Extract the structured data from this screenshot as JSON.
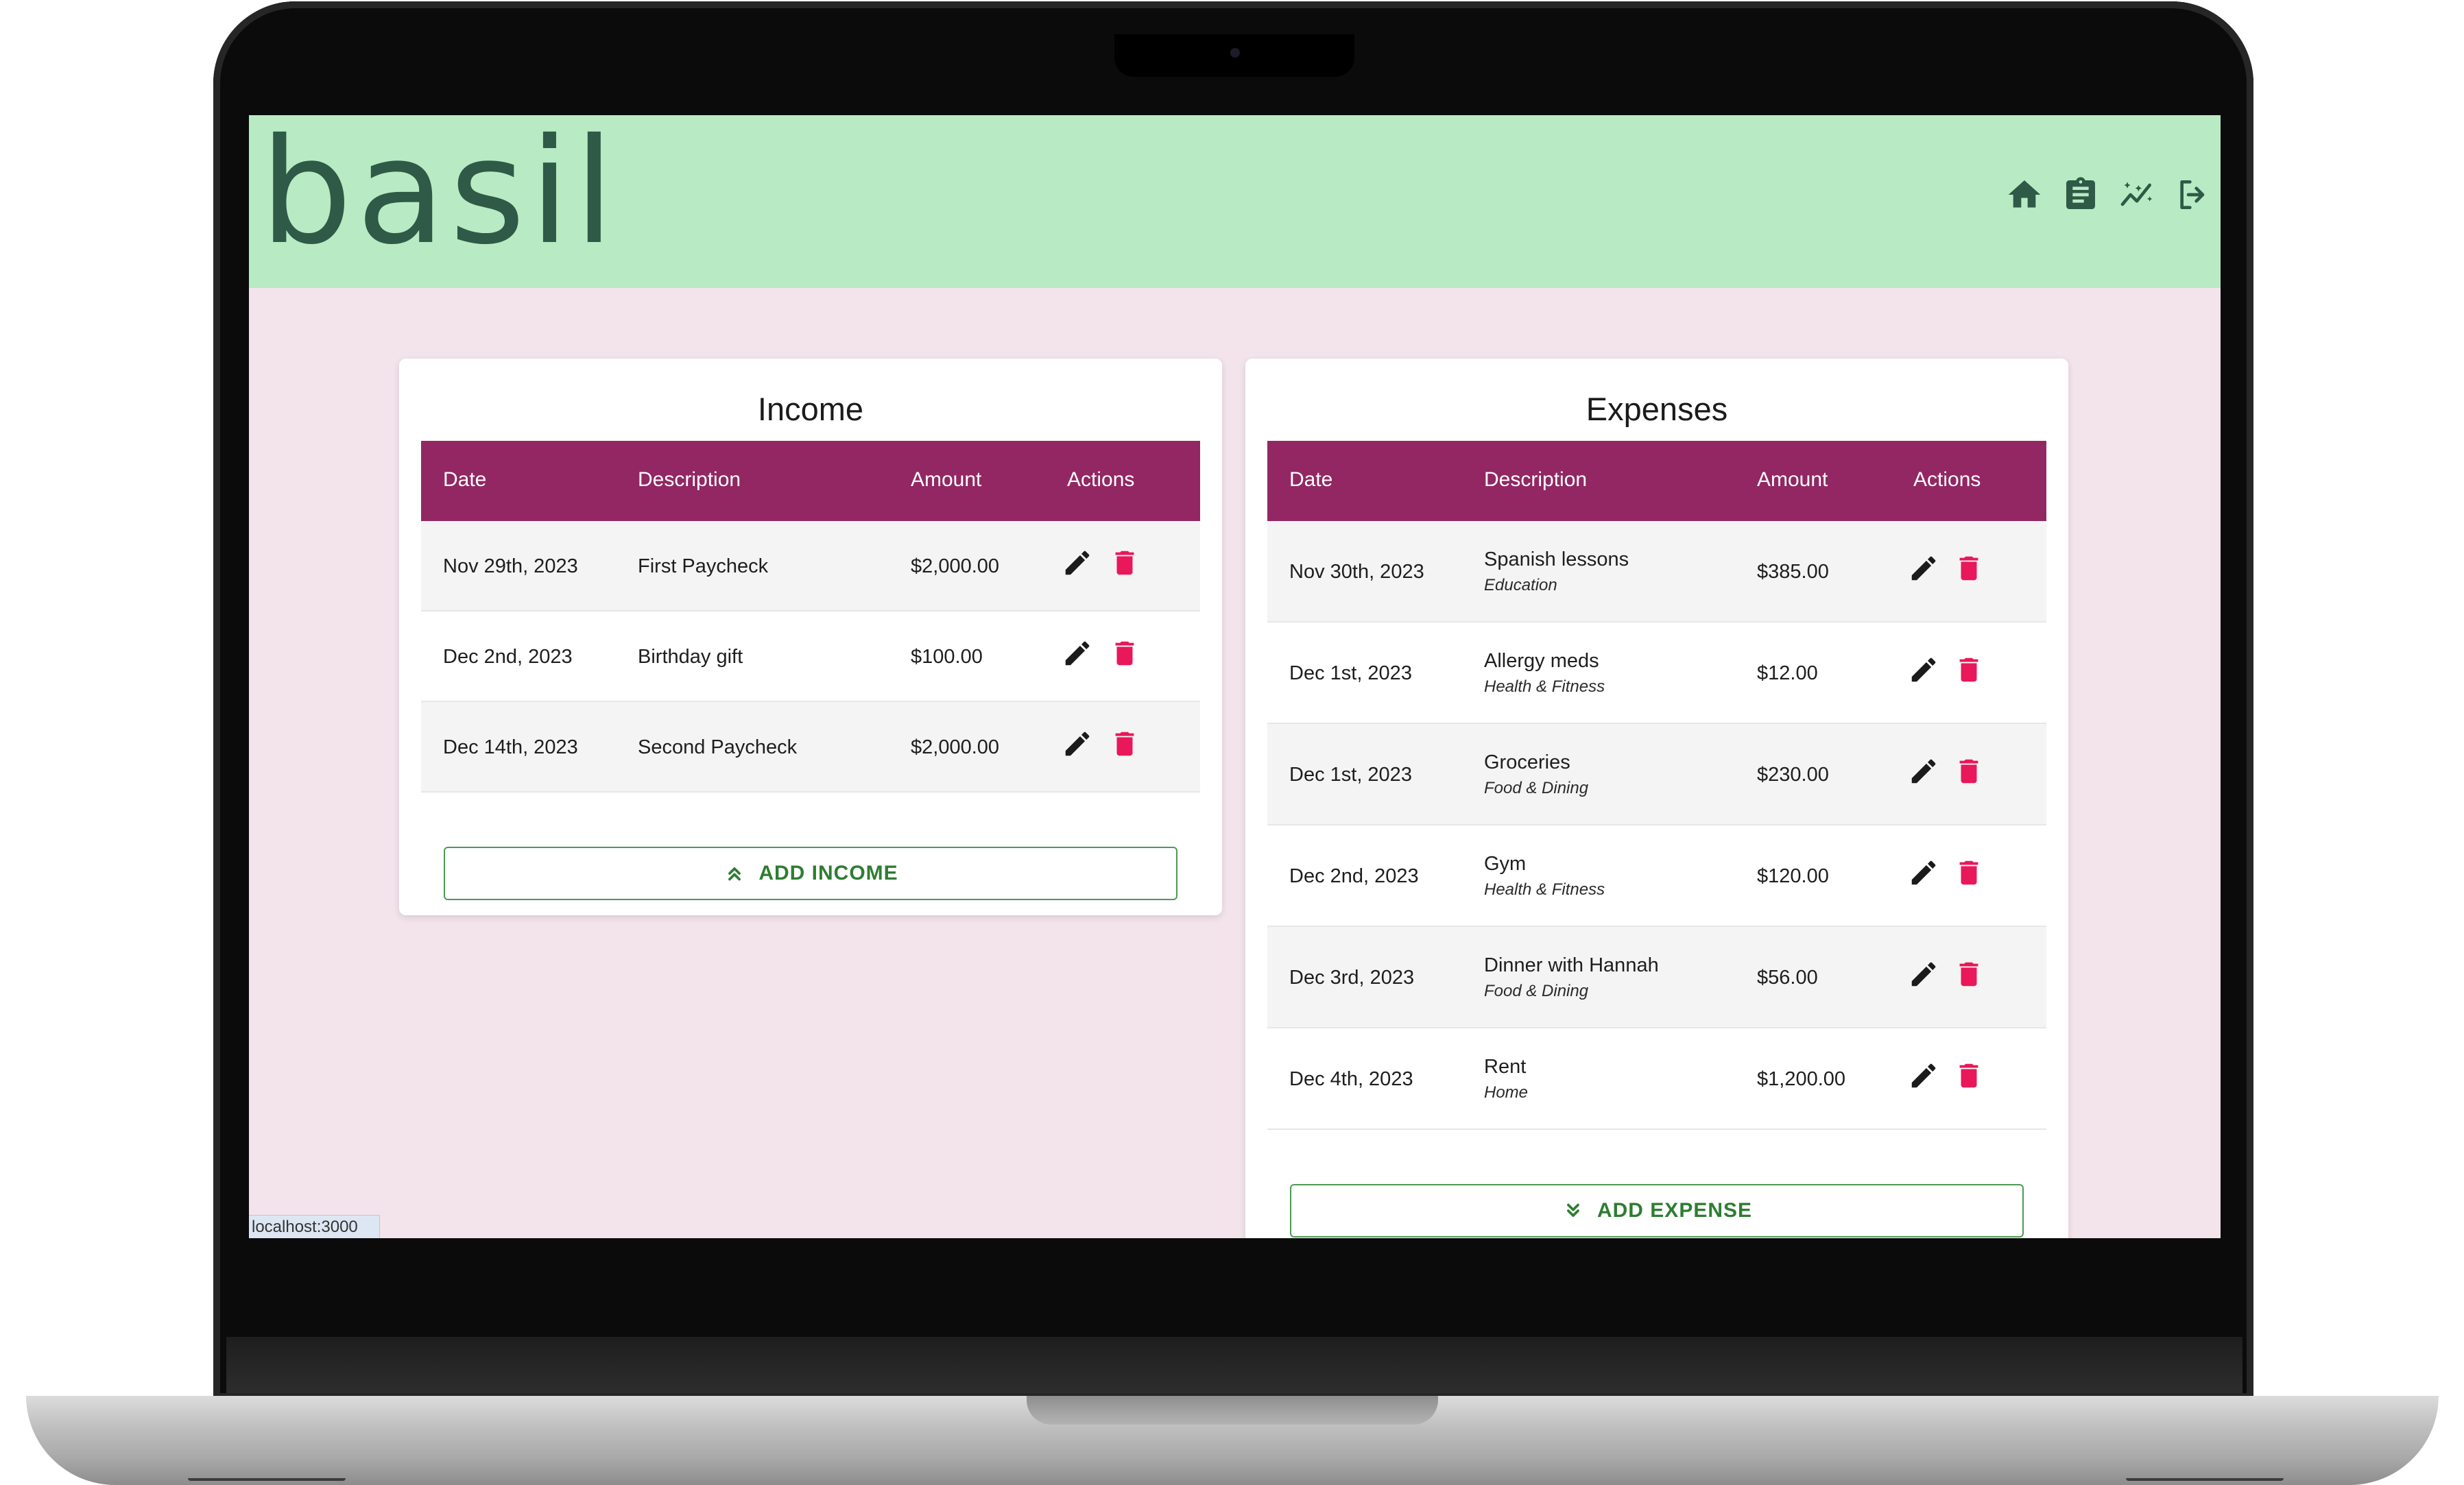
{
  "app": {
    "logo": "basil",
    "status_url": "localhost:3000"
  },
  "nav": [
    {
      "icon": "home-icon"
    },
    {
      "icon": "clipboard-icon"
    },
    {
      "icon": "insights-icon"
    },
    {
      "icon": "logout-icon"
    }
  ],
  "colors": {
    "header_bg": "#b8ebc3",
    "page_bg": "#f3e4ec",
    "table_header": "#922764",
    "delete": "#e8185a",
    "add_button": "#2e7d32"
  },
  "income": {
    "title": "Income",
    "columns": {
      "date": "Date",
      "description": "Description",
      "amount": "Amount",
      "actions": "Actions"
    },
    "rows": [
      {
        "date": "Nov 29th, 2023",
        "description": "First Paycheck",
        "amount": "$2,000.00"
      },
      {
        "date": "Dec 2nd, 2023",
        "description": "Birthday gift",
        "amount": "$100.00"
      },
      {
        "date": "Dec 14th, 2023",
        "description": "Second Paycheck",
        "amount": "$2,000.00"
      }
    ],
    "add_label": "ADD INCOME"
  },
  "expenses": {
    "title": "Expenses",
    "columns": {
      "date": "Date",
      "description": "Description",
      "amount": "Amount",
      "actions": "Actions"
    },
    "rows": [
      {
        "date": "Nov 30th, 2023",
        "description": "Spanish lessons",
        "category": "Education",
        "amount": "$385.00"
      },
      {
        "date": "Dec 1st, 2023",
        "description": "Allergy meds",
        "category": "Health & Fitness",
        "amount": "$12.00"
      },
      {
        "date": "Dec 1st, 2023",
        "description": "Groceries",
        "category": "Food & Dining",
        "amount": "$230.00"
      },
      {
        "date": "Dec 2nd, 2023",
        "description": "Gym",
        "category": "Health & Fitness",
        "amount": "$120.00"
      },
      {
        "date": "Dec 3rd, 2023",
        "description": "Dinner with Hannah",
        "category": "Food & Dining",
        "amount": "$56.00"
      },
      {
        "date": "Dec 4th, 2023",
        "description": "Rent",
        "category": "Home",
        "amount": "$1,200.00"
      }
    ],
    "add_label": "ADD EXPENSE"
  }
}
